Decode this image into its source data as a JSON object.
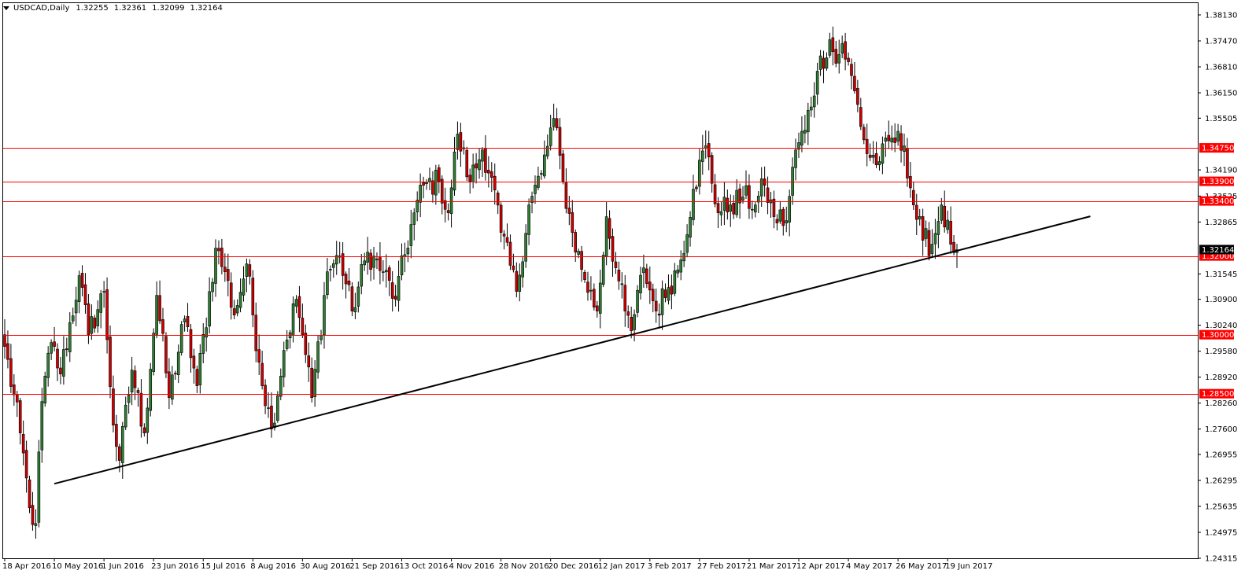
{
  "header": {
    "symbol": "USDCAD,Daily",
    "quotes": [
      "1.32255",
      "1.32361",
      "1.32099",
      "1.32164"
    ]
  },
  "colors": {
    "bull": "#2e7d32",
    "bear": "#cc0000",
    "wick": "#000000",
    "hline": "#ff0000",
    "trendline": "#000000",
    "current_label_bg": "#000000"
  },
  "chart_data": {
    "type": "candlestick",
    "title": "USDCAD,Daily",
    "ylim": [
      1.24315,
      1.3845
    ],
    "y_ticks": [
      "1.38130",
      "1.37470",
      "1.36810",
      "1.36150",
      "1.35505",
      "1.34190",
      "1.33525",
      "1.32865",
      "1.31545",
      "1.30900",
      "1.30240",
      "1.29580",
      "1.28920",
      "1.28260",
      "1.27600",
      "1.26955",
      "1.26295",
      "1.25635",
      "1.24975",
      "1.24315"
    ],
    "x_ticks": [
      {
        "label": "18 Apr 2016",
        "i": 0
      },
      {
        "label": "10 May 2016",
        "i": 16
      },
      {
        "label": "1 Jun 2016",
        "i": 32
      },
      {
        "label": "23 Jun 2016",
        "i": 48
      },
      {
        "label": "15 Jul 2016",
        "i": 64
      },
      {
        "label": "8 Aug 2016",
        "i": 80
      },
      {
        "label": "30 Aug 2016",
        "i": 96
      },
      {
        "label": "21 Sep 2016",
        "i": 112
      },
      {
        "label": "13 Oct 2016",
        "i": 128
      },
      {
        "label": "4 Nov 2016",
        "i": 144
      },
      {
        "label": "28 Nov 2016",
        "i": 160
      },
      {
        "label": "20 Dec 2016",
        "i": 176
      },
      {
        "label": "12 Jan 2017",
        "i": 192
      },
      {
        "label": "3 Feb 2017",
        "i": 208
      },
      {
        "label": "27 Feb 2017",
        "i": 224
      },
      {
        "label": "21 Mar 2017",
        "i": 240
      },
      {
        "label": "12 Apr 2017",
        "i": 256
      },
      {
        "label": "4 May 2017",
        "i": 272
      },
      {
        "label": "26 May 2017",
        "i": 288
      },
      {
        "label": "19 Jun 2017",
        "i": 304
      }
    ],
    "bar_count": 308,
    "horizontal_levels": [
      {
        "value": 1.3475,
        "label": "1.34750"
      },
      {
        "value": 1.339,
        "label": "1.33900"
      },
      {
        "value": 1.334,
        "label": "1.33400"
      },
      {
        "value": 1.32,
        "label": "1.32000"
      },
      {
        "value": 1.3,
        "label": "1.30000"
      },
      {
        "value": 1.285,
        "label": "1.28500"
      }
    ],
    "current_price": {
      "value": 1.32164,
      "label": "1.32164"
    },
    "trendline": {
      "start": {
        "i": 16,
        "price": 1.2621
      },
      "end": {
        "i": 350,
        "price": 1.3301
      }
    },
    "anchors": [
      {
        "i": 0,
        "p": 1.297
      },
      {
        "i": 5,
        "p": 1.275
      },
      {
        "i": 8,
        "p": 1.256
      },
      {
        "i": 10,
        "p": 1.252
      },
      {
        "i": 12,
        "p": 1.283
      },
      {
        "i": 15,
        "p": 1.298
      },
      {
        "i": 18,
        "p": 1.29
      },
      {
        "i": 24,
        "p": 1.315
      },
      {
        "i": 27,
        "p": 1.3
      },
      {
        "i": 32,
        "p": 1.311
      },
      {
        "i": 35,
        "p": 1.277
      },
      {
        "i": 37,
        "p": 1.268
      },
      {
        "i": 41,
        "p": 1.291
      },
      {
        "i": 45,
        "p": 1.275
      },
      {
        "i": 49,
        "p": 1.31
      },
      {
        "i": 53,
        "p": 1.284
      },
      {
        "i": 58,
        "p": 1.304
      },
      {
        "i": 62,
        "p": 1.287
      },
      {
        "i": 68,
        "p": 1.322
      },
      {
        "i": 71,
        "p": 1.316
      },
      {
        "i": 74,
        "p": 1.305
      },
      {
        "i": 78,
        "p": 1.318
      },
      {
        "i": 82,
        "p": 1.293
      },
      {
        "i": 86,
        "p": 1.276
      },
      {
        "i": 90,
        "p": 1.296
      },
      {
        "i": 94,
        "p": 1.309
      },
      {
        "i": 96,
        "p": 1.3
      },
      {
        "i": 99,
        "p": 1.284
      },
      {
        "i": 104,
        "p": 1.316
      },
      {
        "i": 108,
        "p": 1.32
      },
      {
        "i": 112,
        "p": 1.306
      },
      {
        "i": 117,
        "p": 1.321
      },
      {
        "i": 122,
        "p": 1.316
      },
      {
        "i": 126,
        "p": 1.309
      },
      {
        "i": 131,
        "p": 1.328
      },
      {
        "i": 135,
        "p": 1.338
      },
      {
        "i": 140,
        "p": 1.339
      },
      {
        "i": 143,
        "p": 1.331
      },
      {
        "i": 146,
        "p": 1.351
      },
      {
        "i": 150,
        "p": 1.339
      },
      {
        "i": 154,
        "p": 1.347
      },
      {
        "i": 157,
        "p": 1.34
      },
      {
        "i": 160,
        "p": 1.326
      },
      {
        "i": 165,
        "p": 1.311
      },
      {
        "i": 169,
        "p": 1.333
      },
      {
        "i": 173,
        "p": 1.341
      },
      {
        "i": 177,
        "p": 1.355
      },
      {
        "i": 180,
        "p": 1.339
      },
      {
        "i": 183,
        "p": 1.326
      },
      {
        "i": 187,
        "p": 1.314
      },
      {
        "i": 191,
        "p": 1.306
      },
      {
        "i": 194,
        "p": 1.33
      },
      {
        "i": 197,
        "p": 1.317
      },
      {
        "i": 200,
        "p": 1.306
      },
      {
        "i": 202,
        "p": 1.301
      },
      {
        "i": 206,
        "p": 1.317
      },
      {
        "i": 210,
        "p": 1.306
      },
      {
        "i": 214,
        "p": 1.312
      },
      {
        "i": 218,
        "p": 1.319
      },
      {
        "i": 222,
        "p": 1.337
      },
      {
        "i": 226,
        "p": 1.348
      },
      {
        "i": 230,
        "p": 1.331
      },
      {
        "i": 234,
        "p": 1.333
      },
      {
        "i": 238,
        "p": 1.335
      },
      {
        "i": 242,
        "p": 1.333
      },
      {
        "i": 245,
        "p": 1.338
      },
      {
        "i": 248,
        "p": 1.33
      },
      {
        "i": 252,
        "p": 1.329
      },
      {
        "i": 255,
        "p": 1.347
      },
      {
        "i": 258,
        "p": 1.352
      },
      {
        "i": 262,
        "p": 1.367
      },
      {
        "i": 266,
        "p": 1.375
      },
      {
        "i": 268,
        "p": 1.369
      },
      {
        "i": 270,
        "p": 1.374
      },
      {
        "i": 274,
        "p": 1.362
      },
      {
        "i": 278,
        "p": 1.346
      },
      {
        "i": 282,
        "p": 1.344
      },
      {
        "i": 286,
        "p": 1.35
      },
      {
        "i": 290,
        "p": 1.348
      },
      {
        "i": 293,
        "p": 1.333
      },
      {
        "i": 296,
        "p": 1.324
      },
      {
        "i": 299,
        "p": 1.323
      },
      {
        "i": 302,
        "p": 1.333
      },
      {
        "i": 305,
        "p": 1.323
      },
      {
        "i": 307,
        "p": 1.3216
      }
    ]
  }
}
